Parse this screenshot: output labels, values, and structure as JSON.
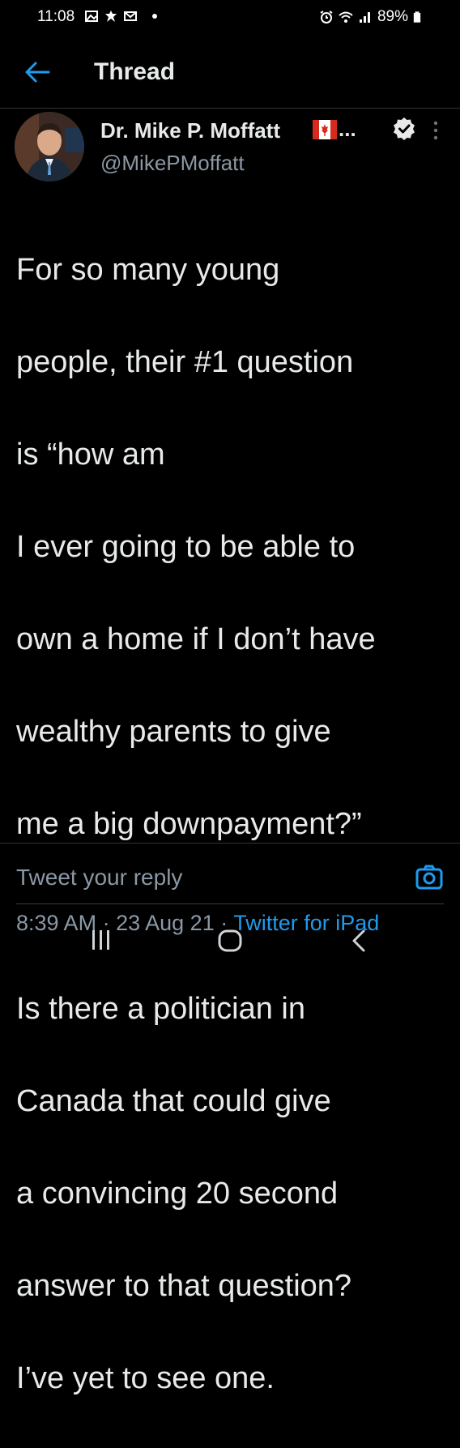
{
  "status_bar": {
    "time": "11:08",
    "battery": "89%",
    "icons": [
      "gallery-icon",
      "leaf-icon",
      "mail-icon",
      "alarm-icon",
      "wifi-icon",
      "signal-icon",
      "battery-icon"
    ]
  },
  "header": {
    "title": "Thread"
  },
  "tweet": {
    "author_name": "Dr. Mike P. Moffatt",
    "author_suffix": "...",
    "handle": "@MikePMoffatt",
    "text_lines": [
      "For so many young",
      "people, their #1 question",
      "is “how am",
      "I ever going to be able to",
      "own a home if I don’t have",
      "wealthy parents to give",
      "me a big downpayment?”",
      "",
      "Is there a politician in",
      "Canada that could give",
      "a convincing 20 second",
      "answer to that question?",
      "I’ve yet to see one."
    ],
    "time": "8:39 AM",
    "separator": "·",
    "date": "23 Aug 21",
    "source": "Twitter for iPad"
  },
  "reply": {
    "placeholder": "Tweet your reply"
  },
  "colors": {
    "background": "#000000",
    "text": "#e7e9ea",
    "muted": "#8b98a5",
    "accent": "#1d9bf0"
  }
}
